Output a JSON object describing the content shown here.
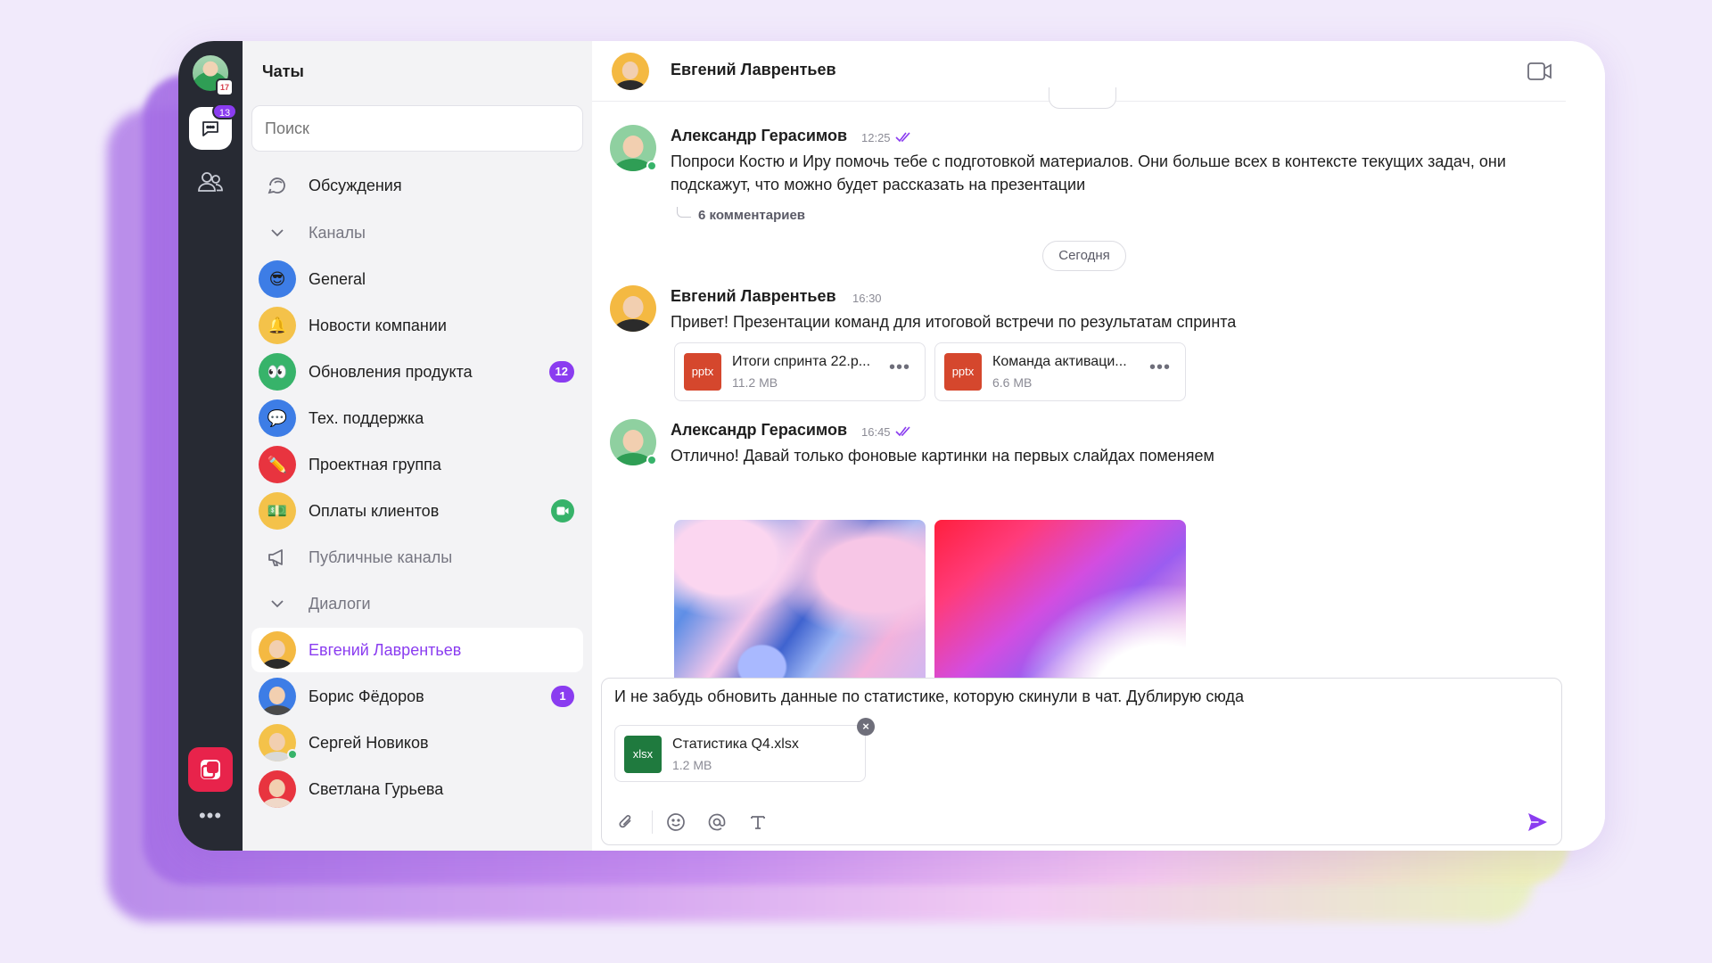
{
  "app": {
    "title": "Чаты",
    "accent": "#8a3cf0"
  },
  "rail": {
    "calendar_day": "17",
    "chat_badge": "13",
    "more": "•••"
  },
  "sidebar": {
    "title": "Чаты",
    "search_placeholder": "Поиск",
    "discussions": "Обсуждения",
    "channels_header": "Каналы",
    "channels": [
      {
        "label": "General",
        "icon": "😎",
        "color": "#3d7de6"
      },
      {
        "label": "Новости компании",
        "icon": "🔔",
        "color": "#f4c24a"
      },
      {
        "label": "Обновления продукта",
        "icon": "👀",
        "color": "#37b36a",
        "count": "12"
      },
      {
        "label": "Тех. поддержка",
        "icon": "💬",
        "color": "#3d7de6"
      },
      {
        "label": "Проектная группа",
        "icon": "✏️",
        "color": "#e8343f"
      },
      {
        "label": "Оплаты клиентов",
        "icon": "💵",
        "color": "#f4c24a",
        "video": true
      }
    ],
    "public_channels": "Публичные каналы",
    "dialogs_header": "Диалоги",
    "dialogs": [
      {
        "label": "Евгений Лаврентьев",
        "active": true,
        "bg": "#f4b942",
        "shirt": "#2b2b2b"
      },
      {
        "label": "Борис Фёдоров",
        "count": "1",
        "bg": "#3d7de6",
        "shirt": "#4a4a4a"
      },
      {
        "label": "Сергей Новиков",
        "online": true,
        "bg": "#f4c24a",
        "shirt": "#d9d9d9"
      },
      {
        "label": "Светлана Гурьева",
        "bg": "#e8343f",
        "shirt": "#f0d8c8"
      }
    ]
  },
  "chat": {
    "header_name": "Евгений Лаврентьев",
    "messages": [
      {
        "author": "Александр Герасимов",
        "time": "12:25",
        "text": "Попроси Костю и Иру помочь тебе с подготовкой материалов. Они больше всех в контексте текущих задач, они подскажут, что можно будет рассказать на презентации",
        "comments": "6 комментариев"
      },
      {
        "author": "Евгений Лаврентьев",
        "time": "16:30",
        "text": "Привет! Презентации команд для итоговой встречи по результатам спринта",
        "files": [
          {
            "ext": "pptx",
            "name": "Итоги спринта 22.p...",
            "size": "11.2 MB",
            "color": "#d5472d"
          },
          {
            "ext": "pptx",
            "name": "Команда активаци...",
            "size": "6.6 MB",
            "color": "#d5472d"
          }
        ]
      },
      {
        "author": "Александр Герасимов",
        "time": "16:45",
        "text": "Отлично! Давай только фоновые картинки на первых слайдах поменяем"
      }
    ],
    "date_divider": "Сегодня",
    "composer": {
      "text": "И не забудь обновить данные по статистике, которую скинули в чат. Дублирую сюда",
      "attachment": {
        "ext": "xlsx",
        "name": "Статистика Q4.xlsx",
        "size": "1.2 MB",
        "color": "#1f7a3e"
      }
    }
  }
}
